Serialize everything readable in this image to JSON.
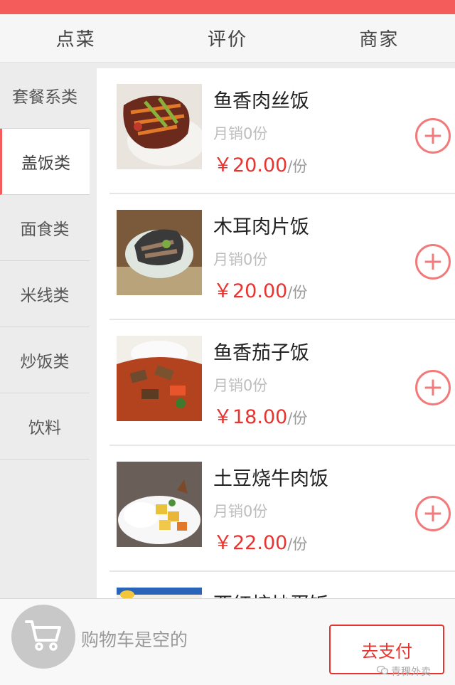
{
  "tabs": [
    "点菜",
    "评价",
    "商家"
  ],
  "categories": [
    "套餐系类",
    "盖饭类",
    "面食类",
    "米线类",
    "炒饭类",
    "饮料"
  ],
  "active_category": "盖饭类",
  "items": [
    {
      "name": "鱼香肉丝饭",
      "sales": "月销0份",
      "price": "￥20.00",
      "unit": "/份",
      "image": "shredded-pork-dish"
    },
    {
      "name": "木耳肉片饭",
      "sales": "月销0份",
      "price": "￥20.00",
      "unit": "/份",
      "image": "wood-ear-pork-dish"
    },
    {
      "name": "鱼香茄子饭",
      "sales": "月销0份",
      "price": "￥18.00",
      "unit": "/份",
      "image": "eggplant-dish"
    },
    {
      "name": "土豆烧牛肉饭",
      "sales": "月销0份",
      "price": "￥22.00",
      "unit": "/份",
      "image": "potato-beef-dish"
    },
    {
      "name": "西红柿炒蛋饭",
      "sales": "",
      "price": "",
      "unit": "",
      "image": "tomato-egg-dish"
    }
  ],
  "cart": {
    "empty_text": "购物车是空的",
    "icon": "cart-icon"
  },
  "pay_button": "去支付",
  "watermark": "青稞外卖",
  "colors": {
    "accent": "#f45c5c",
    "price": "#e8332f",
    "add": "#f27a7a"
  }
}
